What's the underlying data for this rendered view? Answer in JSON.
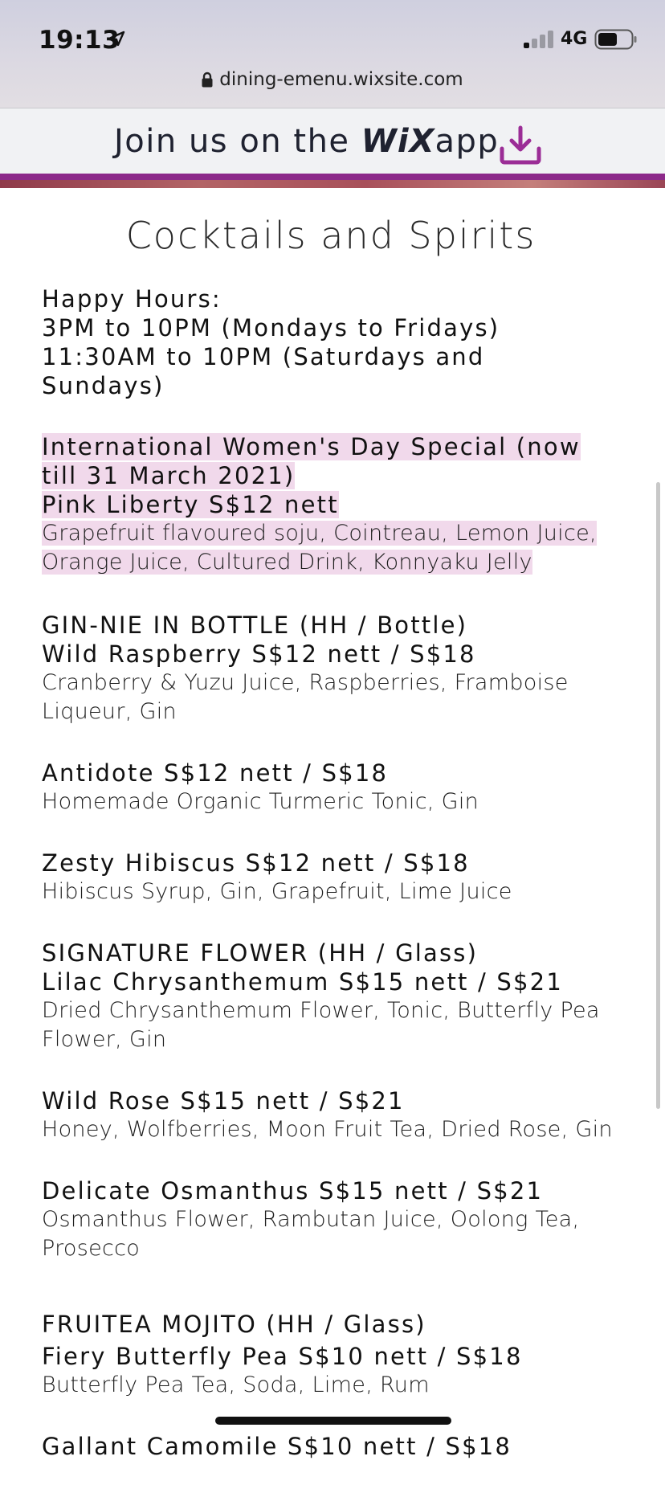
{
  "status_bar": {
    "time": "19:13",
    "network": "4G",
    "icons": [
      "location-arrow-icon",
      "signal-bars-icon",
      "battery-icon"
    ]
  },
  "browser": {
    "url": "dining-emenu.wixsite.com",
    "icons": [
      "lock-icon"
    ]
  },
  "banner": {
    "text_before": "Join us on the",
    "brand": "WiX",
    "text_after": "app",
    "accent_color": "#8d2a8a",
    "icons": [
      "download-icon"
    ]
  },
  "page": {
    "title": "Cocktails and Spirits",
    "happy_hours": {
      "heading": "Happy Hours:",
      "weekday": "3PM to 10PM (Mondays to Fridays)",
      "weekend_1": "11:30AM to 10PM (Saturdays and",
      "weekend_2": "Sundays)"
    },
    "special": {
      "line1": "International Women's Day Special (now",
      "line2": "till 31 March 2021)",
      "item": "Pink Liberty S$12 nett",
      "desc1": "Grapefruit flavoured soju, Cointreau, Lemon Juice,",
      "desc2": "Orange Juice, Cultured Drink, Konnyaku Jelly",
      "highlight_color": "#f1d9eb"
    },
    "sections": [
      {
        "heading": "GIN-NIE IN BOTTLE (HH / Bottle)",
        "items": [
          {
            "name": "Wild Raspberry S$12 nett / S$18",
            "desc1": "Cranberry & Yuzu Juice, Raspberries, Framboise",
            "desc2": "Liqueur, Gin"
          },
          {
            "name": "Antidote S$12 nett / S$18",
            "desc1": "Homemade Organic Turmeric Tonic, Gin"
          },
          {
            "name": "Zesty Hibiscus S$12 nett / S$18",
            "desc1": "Hibiscus Syrup, Gin, Grapefruit, Lime Juice"
          }
        ]
      },
      {
        "heading": "SIGNATURE FLOWER (HH / Glass)",
        "items": [
          {
            "name": "Lilac Chrysanthemum S$15 nett / S$21",
            "desc1": "Dried Chrysanthemum Flower, Tonic, Butterfly Pea",
            "desc2": "Flower, Gin"
          },
          {
            "name": "Wild Rose S$15 nett / S$21",
            "desc1": "Honey, Wolfberries, Moon Fruit Tea, Dried Rose, Gin"
          },
          {
            "name": "Delicate Osmanthus S$15 nett / S$21",
            "desc1": "Osmanthus Flower, Rambutan Juice, Oolong Tea,",
            "desc2": "Prosecco"
          }
        ]
      },
      {
        "heading": "FRUITEA MOJITO (HH / Glass)",
        "items": [
          {
            "name": "Fiery Butterfly Pea S$10 nett / S$18",
            "desc1": "Butterfly Pea Tea,  Soda, Lime, Rum"
          },
          {
            "name": "Gallant Camomile S$10 nett / S$18"
          }
        ]
      }
    ]
  }
}
